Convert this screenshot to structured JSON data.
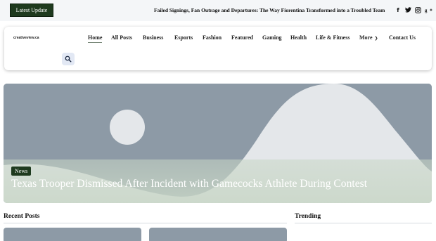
{
  "topbar": {
    "latest_label": "Latest Update",
    "ticker_text": "Failed Signings, Fan Outrage and Departures: The Way Fiorentina Transformed into a Troubled Team",
    "social": [
      {
        "name": "facebook-icon",
        "glyph": "f"
      },
      {
        "name": "twitter-icon",
        "glyph": "t"
      },
      {
        "name": "instagram-icon",
        "glyph": "ig"
      },
      {
        "name": "google-plus-icon",
        "glyph": "g+"
      }
    ]
  },
  "header": {
    "logo_text": "creativeview.ca",
    "nav": [
      "Home",
      "All Posts",
      "Business",
      "Esports",
      "Fashion",
      "Featured",
      "Gaming",
      "Health",
      "Life & Fitness",
      "More",
      "Contact Us"
    ],
    "search_icon": "search-icon"
  },
  "hero": {
    "badge": "News",
    "title": "Texas Trooper Dismissed After Incident with Gamecocks Athlete During Contest"
  },
  "sections": {
    "recent": "Recent Posts",
    "trending": "Trending"
  },
  "colors": {
    "accent": "#1e3a1e",
    "placeholder_bg": "#8d9aa6",
    "placeholder_fg": "#e4e7ea"
  }
}
